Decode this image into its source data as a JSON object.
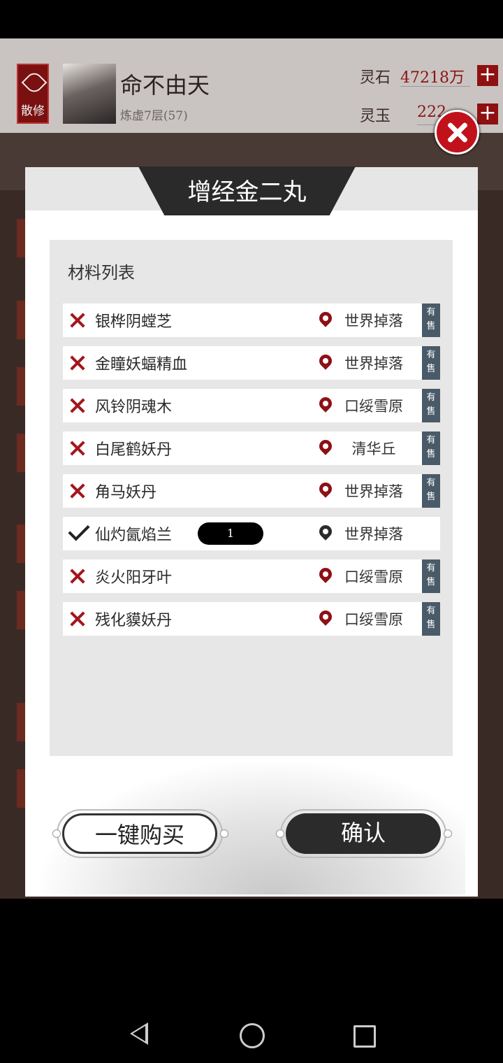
{
  "background": {
    "sect_badge": "散修",
    "player_name": "命不由天",
    "player_level": "炼虚7层(57)",
    "resources": [
      {
        "label": "灵石",
        "value": "47218万"
      },
      {
        "label": "灵玉",
        "value": "222"
      }
    ]
  },
  "dialog": {
    "title": "增经金二丸",
    "materials_header": "材料列表",
    "materials": [
      {
        "name": "银桦阴螳芝",
        "owned": false,
        "location": "世界掉落",
        "sale_tag": "有售"
      },
      {
        "name": "金瞳妖蝠精血",
        "owned": false,
        "location": "世界掉落",
        "sale_tag": "有售"
      },
      {
        "name": "风铃阴魂木",
        "owned": false,
        "location": "口绥雪原",
        "sale_tag": "有售"
      },
      {
        "name": "白尾鹤妖丹",
        "owned": false,
        "location": "清华丘",
        "sale_tag": "有售"
      },
      {
        "name": "角马妖丹",
        "owned": false,
        "location": "世界掉落",
        "sale_tag": "有售"
      },
      {
        "name": "仙灼氤焰兰",
        "owned": true,
        "quantity": "1",
        "location": "世界掉落"
      },
      {
        "name": "炎火阳牙叶",
        "owned": false,
        "location": "口绥雪原",
        "sale_tag": "有售"
      },
      {
        "name": "残化貘妖丹",
        "owned": false,
        "location": "口绥雪原",
        "sale_tag": "有售"
      }
    ],
    "buy_all_label": "一键购买",
    "confirm_label": "确认"
  },
  "colors": {
    "accent_red": "#a3161c",
    "close_red": "#c1121b",
    "sale_tag": "#4a5a68",
    "title_bar": "#2a2a2a"
  },
  "icons": [
    "close-icon",
    "cross-icon",
    "check-icon",
    "location-pin-icon",
    "nav-back-icon",
    "nav-home-icon",
    "nav-recent-icon"
  ]
}
